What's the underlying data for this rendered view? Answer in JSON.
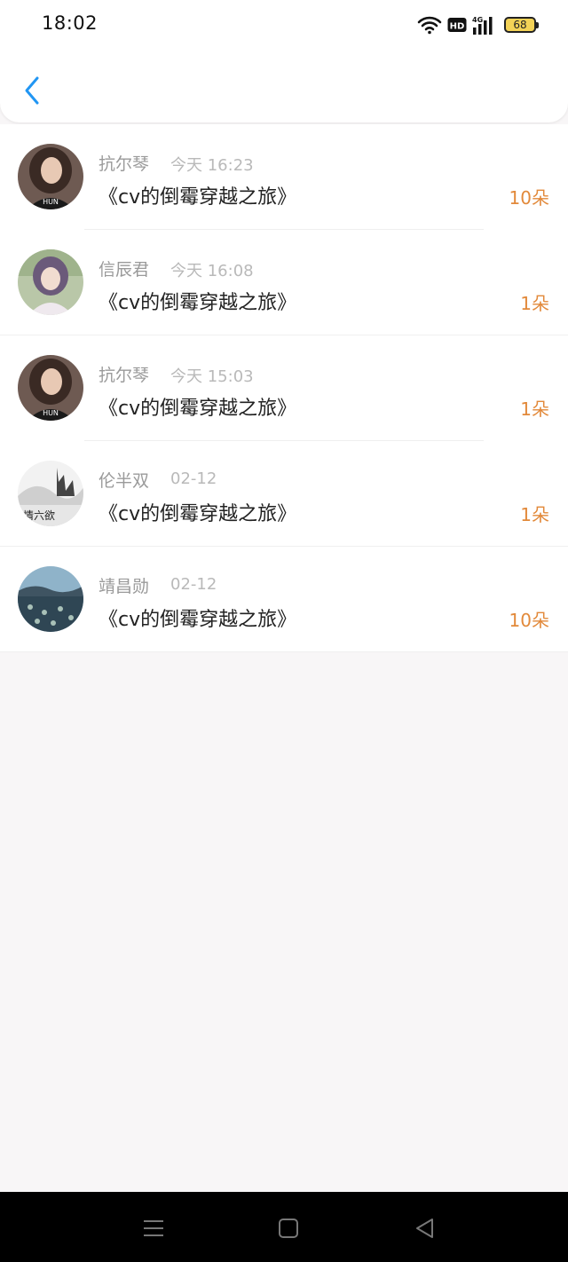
{
  "status_bar": {
    "time": "18:02",
    "battery_level": "68",
    "network": "4G",
    "hd_badge": "HD",
    "icons": [
      "wifi-icon",
      "hd-icon",
      "signal-4g-icon",
      "battery-icon"
    ]
  },
  "header": {
    "back_icon": "chevron-left-icon",
    "accent_color": "#2196f3"
  },
  "gifts": [
    {
      "name": "抗尔琴",
      "time": "今天 16:23",
      "title": "《cv的倒霉穿越之旅》",
      "amount": "10朵"
    },
    {
      "name": "信辰君",
      "time": "今天 16:08",
      "title": "《cv的倒霉穿越之旅》",
      "amount": "1朵"
    },
    {
      "name": "抗尔琴",
      "time": "今天 15:03",
      "title": "《cv的倒霉穿越之旅》",
      "amount": "1朵"
    },
    {
      "name": "伦半双",
      "time": "02-12",
      "title": "《cv的倒霉穿越之旅》",
      "amount": "1朵"
    },
    {
      "name": "靖昌勋",
      "time": "02-12",
      "title": "《cv的倒霉穿越之旅》",
      "amount": "10朵"
    }
  ],
  "avatar_overlay_text": "情六欲",
  "colors": {
    "amount": "#e2893a",
    "name": "#9a9a9a",
    "time": "#b9b9b9",
    "background": "#f8f6f7"
  },
  "nav_bar": {
    "icons": [
      "menu-icon",
      "home-icon",
      "back-triangle-icon"
    ]
  }
}
